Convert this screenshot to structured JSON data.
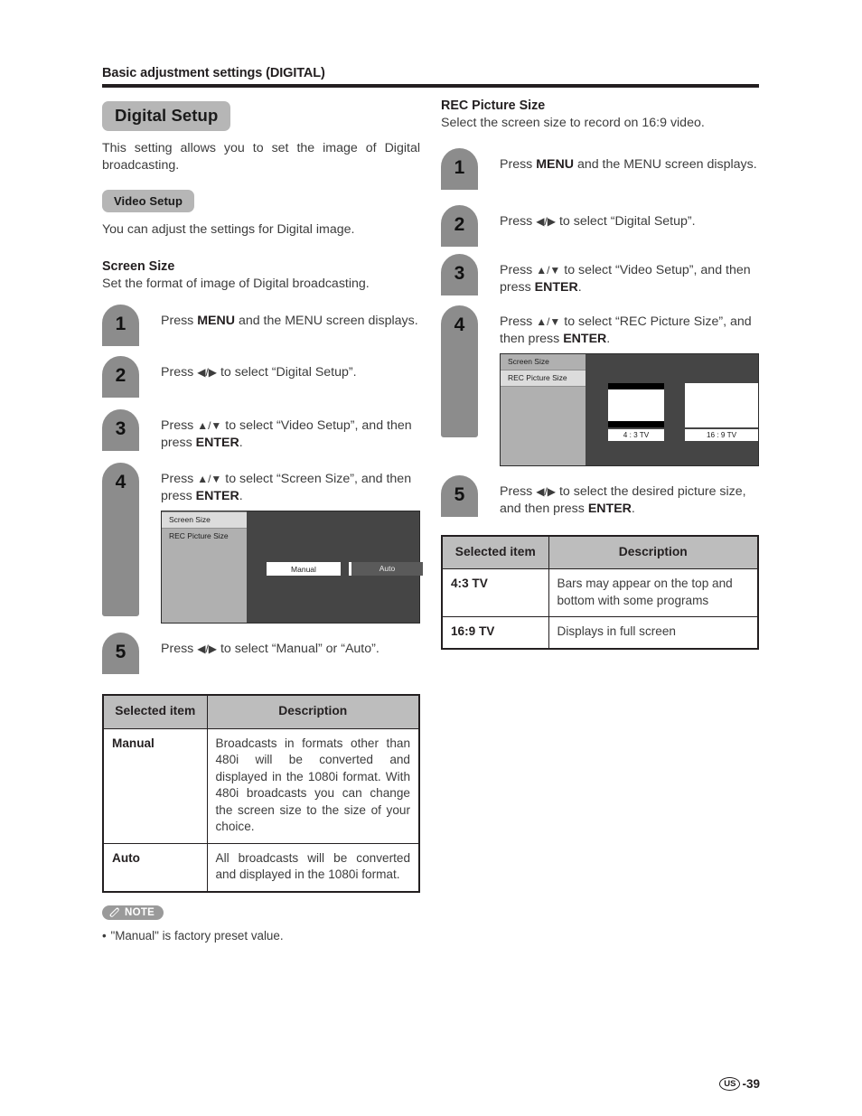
{
  "runhead": {
    "title": "Basic adjustment settings (DIGITAL)"
  },
  "left": {
    "heading": "Digital Setup",
    "intro": "This setting allows you to set the image of Digital broadcasting.",
    "subheading_pill": "Video Setup",
    "pill_text": "You can adjust the settings for Digital image.",
    "section_title": "Screen Size",
    "section_desc": "Set the format of image of Digital broadcasting.",
    "steps": [
      {
        "num": "1",
        "text_1": "Press ",
        "bold_1": "MENU",
        "text_2": " and the MENU screen displays."
      },
      {
        "num": "2",
        "text_1": "Press ",
        "arrows": "◀/▶",
        "text_2": " to select “Digital Setup”."
      },
      {
        "num": "3",
        "text_1": "Press ",
        "arrows": "▲/▼",
        "text_2": " to select “Video Setup”, and then press ",
        "bold_2": "ENTER",
        "text_3": "."
      },
      {
        "num": "4",
        "text_1": "Press ",
        "arrows": "▲/▼",
        "text_2": " to select “Screen Size”, and then press ",
        "bold_2": "ENTER",
        "text_3": "."
      },
      {
        "num": "5",
        "text_1": "Press ",
        "arrows": "◀/▶",
        "text_2": " to select “Manual” or “Auto”."
      }
    ],
    "osd": {
      "menu_items": [
        "Screen Size",
        "REC Picture Size"
      ],
      "selected_menu_item": "Screen Size",
      "buttons": [
        "Manual",
        "Auto"
      ],
      "selected_button": "Manual"
    },
    "table": {
      "header_item": "Selected item",
      "header_desc": "Description",
      "rows": [
        {
          "item": "Manual",
          "desc": "Broadcasts in formats other than 480i will be converted and displayed in the 1080i format. With 480i broadcasts you can change the screen size to the size of your choice."
        },
        {
          "item": "Auto",
          "desc": "All broadcasts will be converted and displayed in the 1080i format."
        }
      ]
    },
    "note": {
      "label": "NOTE",
      "bullet": "•",
      "text": "\"Manual\"  is factory preset value."
    }
  },
  "right": {
    "section_title": "REC Picture Size",
    "section_desc": "Select the screen size to record on 16:9 video.",
    "steps": [
      {
        "num": "1",
        "text_1": "Press ",
        "bold_1": "MENU",
        "text_2": " and the MENU screen displays."
      },
      {
        "num": "2",
        "text_1": "Press ",
        "arrows": "◀/▶",
        "text_2": " to select “Digital Setup”."
      },
      {
        "num": "3",
        "text_1": "Press ",
        "arrows": "▲/▼",
        "text_2": " to select “Video Setup”, and then press ",
        "bold_2": "ENTER",
        "text_3": "."
      },
      {
        "num": "4",
        "text_1": "Press ",
        "arrows": "▲/▼",
        "text_2": " to select “REC Picture Size”, and then press ",
        "bold_2": "ENTER",
        "text_3": "."
      },
      {
        "num": "5",
        "text_1": "Press ",
        "arrows": "◀/▶",
        "text_2": " to select the desired picture size, and then press ",
        "bold_2": "ENTER",
        "text_3": "."
      }
    ],
    "osd": {
      "menu_items": [
        "Screen Size",
        "REC Picture Size"
      ],
      "selected_menu_item": "REC Picture Size",
      "thumb_labels": [
        "4 : 3 TV",
        "16 : 9 TV"
      ]
    },
    "table": {
      "header_item": "Selected item",
      "header_desc": "Description",
      "rows": [
        {
          "item": "4:3 TV",
          "desc": "Bars may appear on the top and bottom with some programs"
        },
        {
          "item": "16:9 TV",
          "desc": "Displays in full screen"
        }
      ]
    }
  },
  "footer": {
    "region": "US",
    "page": "-39"
  },
  "colors": {
    "pill_grey": "#b6b6b6",
    "badge_grey": "#8c8c8c",
    "table_header_grey": "#bdbdbd",
    "osd_background": "#454545",
    "osd_sidebar": "#b0b0b0",
    "osd_selected": "#dcdcdc",
    "ink": "#231f20",
    "body_grey": "#3c3c3c"
  }
}
